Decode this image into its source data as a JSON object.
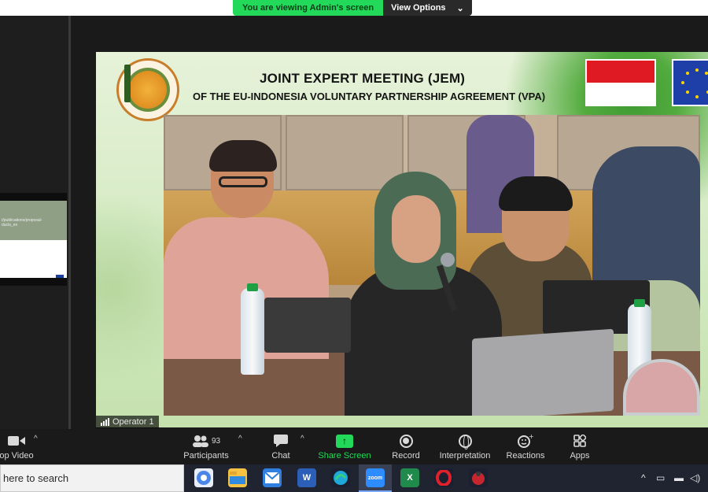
{
  "banner": {
    "viewing_text": "You are viewing Admin's screen",
    "view_options_label": "View Options",
    "caret": "⌄"
  },
  "thumbnail": {
    "text_lines": [
      "t/publications/proposal-",
      "ducts_en"
    ]
  },
  "shared_screen": {
    "title": "JOINT EXPERT MEETING (JEM)",
    "subtitle": "OF THE EU-INDONESIA VOLUNTARY PARTNERSHIP AGREEMENT (VPA)",
    "colors": {
      "indonesia_red": "#e01a22",
      "eu_blue": "#1f3fa8",
      "eu_star": "#ffd400"
    }
  },
  "video": {
    "operator_label": "Operator 1"
  },
  "toolbar": {
    "items": [
      {
        "label": "op Video",
        "icon": "video-camera-icon"
      },
      {
        "label": "Participants",
        "icon": "participants-icon",
        "count": "93"
      },
      {
        "label": "Chat",
        "icon": "chat-icon"
      },
      {
        "label": "Share Screen",
        "icon": "share-screen-icon"
      },
      {
        "label": "Record",
        "icon": "record-icon"
      },
      {
        "label": "Interpretation",
        "icon": "globe-icon"
      },
      {
        "label": "Reactions",
        "icon": "reactions-icon"
      },
      {
        "label": "Apps",
        "icon": "apps-icon"
      }
    ],
    "caret": "^",
    "accent": "#23d959"
  },
  "taskbar": {
    "search_text": "here to search",
    "apps": [
      {
        "name": "chrome-icon",
        "color": "#4a86e8"
      },
      {
        "name": "file-explorer-icon",
        "color": "#f6c244"
      },
      {
        "name": "mail-icon",
        "color": "#2f7ee0"
      },
      {
        "name": "word-icon",
        "color": "#2b5fb8"
      },
      {
        "name": "edge-icon",
        "color": "#1fa8d8"
      },
      {
        "name": "zoom-icon",
        "color": "#2d8cff",
        "text": "zoom"
      },
      {
        "name": "excel-icon",
        "color": "#1f8a4c"
      },
      {
        "name": "opera-icon",
        "color": "#e0202a"
      },
      {
        "name": "game-icon",
        "color": "#c7262e"
      }
    ]
  }
}
